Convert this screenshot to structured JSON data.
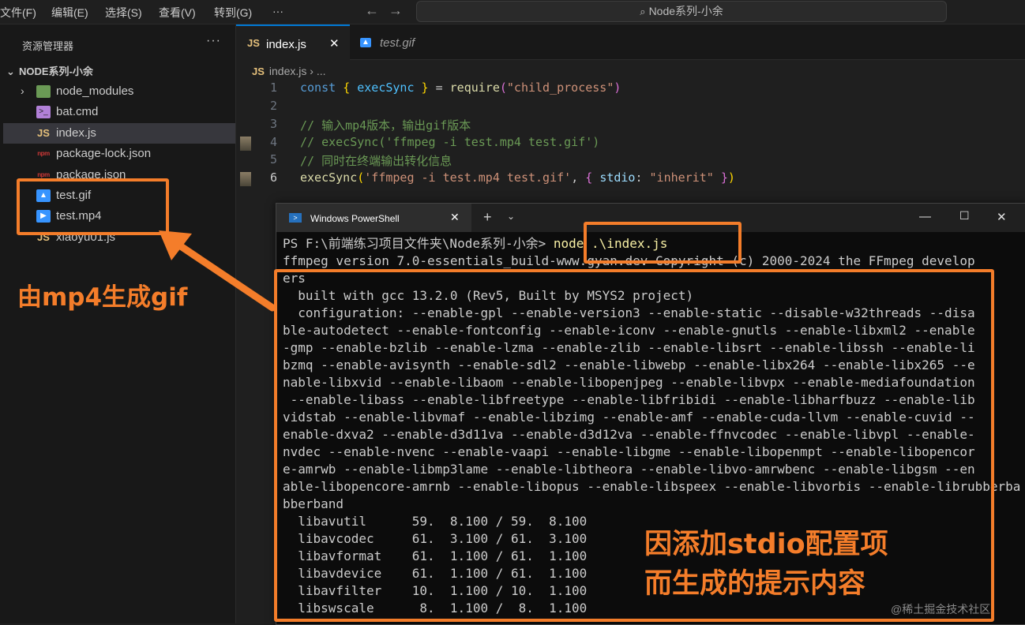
{
  "menu": [
    "文件(F)",
    "编辑(E)",
    "选择(S)",
    "查看(V)",
    "转到(G)",
    "···"
  ],
  "search": {
    "text": "Node系列-小余"
  },
  "sidebar": {
    "title": "资源管理器",
    "more": "···",
    "folder": "NODE系列-小余",
    "items": [
      {
        "label": "node_modules",
        "icon": "folder-icon"
      },
      {
        "label": "bat.cmd",
        "icon": "cmd-icon"
      },
      {
        "label": "index.js",
        "icon": "js-icon"
      },
      {
        "label": "package-lock.json",
        "icon": "npm-icon"
      },
      {
        "label": "package.json",
        "icon": "npm-icon"
      },
      {
        "label": "test.gif",
        "icon": "image-icon"
      },
      {
        "label": "test.mp4",
        "icon": "video-icon"
      },
      {
        "label": "xiaoyu01.js",
        "icon": "js-icon"
      }
    ]
  },
  "tabs": [
    {
      "label": "index.js",
      "icon": "JS"
    },
    {
      "label": "test.gif",
      "icon": "image-icon"
    }
  ],
  "breadcrumb": {
    "icon": "JS",
    "path": "index.js › ..."
  },
  "code": {
    "line_numbers": [
      "1",
      "2",
      "3",
      "4",
      "5",
      "6"
    ]
  },
  "terminal": {
    "title": "Windows PowerShell",
    "prompt": "PS F:\\前端练习项目文件夹\\Node系列-小余> ",
    "command": "node .\\index.js",
    "output": [
      "ffmpeg version 7.0-essentials_build-www.gyan.dev Copyright (c) 2000-2024 the FFmpeg develop",
      "ers",
      "  built with gcc 13.2.0 (Rev5, Built by MSYS2 project)",
      "  configuration: --enable-gpl --enable-version3 --enable-static --disable-w32threads --disa",
      "ble-autodetect --enable-fontconfig --enable-iconv --enable-gnutls --enable-libxml2 --enable",
      "-gmp --enable-bzlib --enable-lzma --enable-zlib --enable-libsrt --enable-libssh --enable-li",
      "bzmq --enable-avisynth --enable-sdl2 --enable-libwebp --enable-libx264 --enable-libx265 --e",
      "nable-libxvid --enable-libaom --enable-libopenjpeg --enable-libvpx --enable-mediafoundation",
      " --enable-libass --enable-libfreetype --enable-libfribidi --enable-libharfbuzz --enable-lib",
      "vidstab --enable-libvmaf --enable-libzimg --enable-amf --enable-cuda-llvm --enable-cuvid --",
      "enable-dxva2 --enable-d3d11va --enable-d3d12va --enable-ffnvcodec --enable-libvpl --enable-",
      "nvdec --enable-nvenc --enable-vaapi --enable-libgme --enable-libopenmpt --enable-libopencor",
      "e-amrwb --enable-libmp3lame --enable-libtheora --enable-libvo-amrwbenc --enable-libgsm --en",
      "able-libopencore-amrnb --enable-libopus --enable-libspeex --enable-libvorbis --enable-librubberband",
      "bberband",
      "  libavutil      59.  8.100 / 59.  8.100",
      "  libavcodec     61.  3.100 / 61.  3.100",
      "  libavformat    61.  1.100 / 61.  1.100",
      "  libavdevice    61.  1.100 / 61.  1.100",
      "  libavfilter    10.  1.100 / 10.  1.100",
      "  libswscale      8.  1.100 /  8.  1.100"
    ]
  },
  "annotations": {
    "left": "由mp4生成gif",
    "right_line1": "因添加stdio配置项",
    "right_line2": "而生成的提示内容"
  },
  "watermark": "@稀土掘金技术社区",
  "colors": {
    "accent": "#0078d4",
    "annotation": "#f47d2a"
  }
}
